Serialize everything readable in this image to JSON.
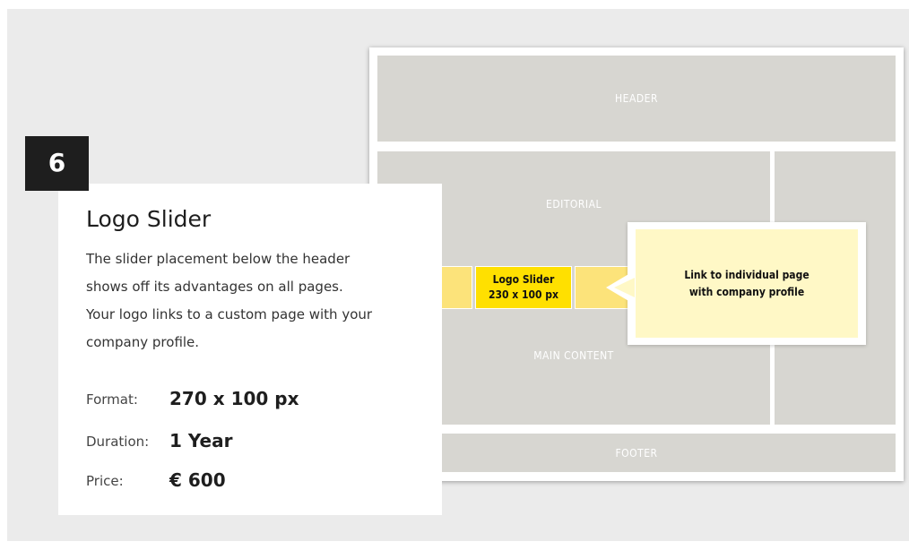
{
  "wireframe": {
    "header": "HEADER",
    "editorial": "EDITORIAL",
    "main_content": "MAIN CONTENT",
    "footer": "FOOTER"
  },
  "slider": {
    "label_line1": "Logo Slider",
    "label_line2": "230 x 100 px"
  },
  "callout": {
    "line1": "Link to individual page",
    "line2": "with company profile"
  },
  "card": {
    "number": "6",
    "title": "Logo Slider",
    "description_lines": [
      "The slider placement below the header",
      "shows off its advantages on all pages.",
      "Your logo links to a custom page with your",
      "company profile."
    ],
    "specs": [
      {
        "label": "Format:",
        "value": "270 x 100 px"
      },
      {
        "label": "Duration:",
        "value": "1 Year"
      },
      {
        "label": "Price:",
        "value": "€ 600"
      }
    ]
  },
  "colors": {
    "background": "#ebebeb",
    "block": "#d7d6d1",
    "slider_highlight": "#ffe000",
    "slider_side": "#fce37a",
    "callout_fill": "#fff8c6",
    "badge": "#1e1e1e"
  }
}
